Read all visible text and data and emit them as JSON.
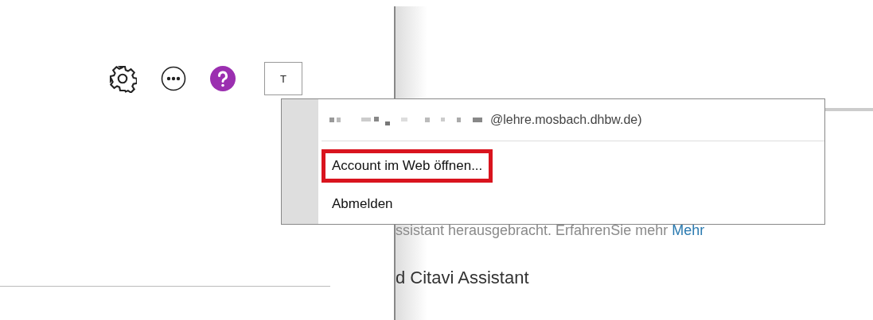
{
  "toolbar": {
    "avatar": "T"
  },
  "account_menu": {
    "email": "@lehre.mosbach.dhbw.de)",
    "items": [
      {
        "label": "Account im Web öffnen...",
        "highlighted": true
      },
      {
        "label": "Abmelden",
        "highlighted": false
      }
    ]
  },
  "content": {
    "line": "ssistant herausgebracht. ErfahrenSie mehr",
    "link": "Mehr",
    "heading": "d Citavi Assistant"
  }
}
